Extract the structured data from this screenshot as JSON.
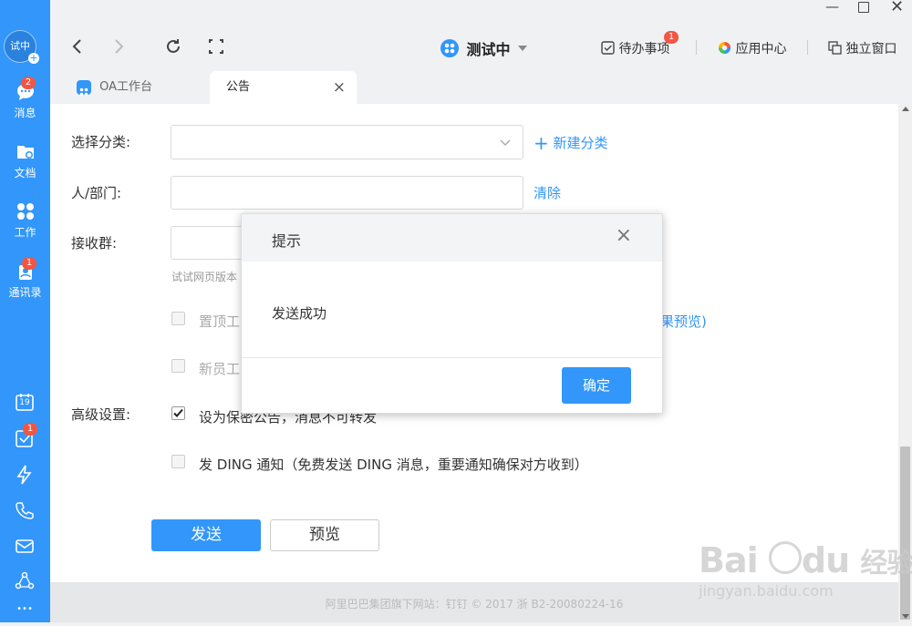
{
  "sidebar": {
    "avatar_text": "试中",
    "items": [
      {
        "label": "消息",
        "icon": "chat-bubble-icon",
        "badge": "2"
      },
      {
        "label": "文档",
        "icon": "folder-icon",
        "badge": ""
      },
      {
        "label": "工作",
        "icon": "grid-icon",
        "badge": ""
      },
      {
        "label": "通讯录",
        "icon": "contacts-icon",
        "badge": "1"
      }
    ],
    "tools": [
      {
        "icon": "calendar-icon",
        "text": "19"
      },
      {
        "icon": "todo-check-icon",
        "badge": "1"
      },
      {
        "icon": "ding-lightning-icon"
      },
      {
        "icon": "phone-icon"
      },
      {
        "icon": "mail-icon"
      },
      {
        "icon": "share-network-icon"
      },
      {
        "icon": "more-dots-icon",
        "text": "•••"
      }
    ]
  },
  "titlebar": {
    "workspace_name": "测试中",
    "todo_label": "待办事项",
    "todo_badge": "1",
    "app_center_label": "应用中心",
    "standalone_label": "独立窗口"
  },
  "tabs": [
    {
      "label": "OA工作台",
      "active": false
    },
    {
      "label": "公告",
      "active": true,
      "close": "×"
    }
  ],
  "form": {
    "category_label": "选择分类:",
    "new_category_label": "新建分类",
    "people_label": "人/部门:",
    "clear_label": "清除",
    "group_label": "接收群:",
    "hint_text": "试试网页版本",
    "pin_option": "置顶工",
    "preview_link_tail": "果预览)",
    "newbie_option": "新员工",
    "advanced_label": "高级设置:",
    "confidential_option": "设为保密公告，消息不可转发",
    "confidential_checked": true,
    "ding_option": "发 DING 通知（免费发送 DING 消息，重要通知确保对方收到）",
    "ding_checked": false,
    "send_button": "发送",
    "preview_button": "预览"
  },
  "dialog": {
    "title": "提示",
    "message": "发送成功",
    "confirm_button": "确定",
    "close": "×"
  },
  "footer": {
    "text": "阿里巴巴集团旗下网站：钉钉 © 2017 浙 B2-20080224-16"
  },
  "watermark": {
    "brand": "Bai",
    "brand_tail": "du",
    "cn": "经验",
    "url": "jingyan.baidu.com"
  },
  "colors": {
    "primary": "#3296fa",
    "badge": "#f25643"
  }
}
